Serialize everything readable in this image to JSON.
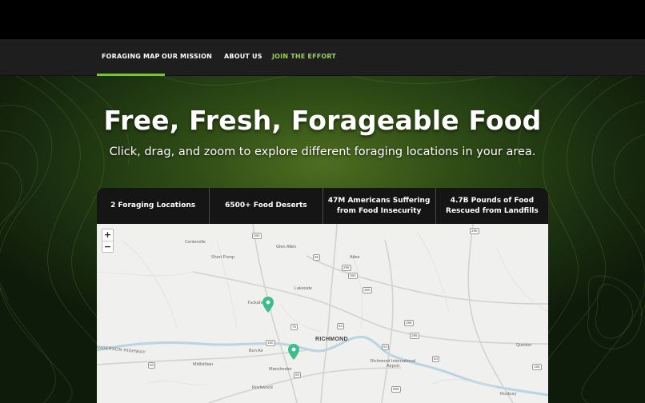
{
  "nav": {
    "items": [
      {
        "label": "FORAGING MAP",
        "active": true
      },
      {
        "label": "OUR MISSION"
      },
      {
        "label": "ABOUT US"
      },
      {
        "label": "JOIN THE EFFORT",
        "accent": true
      }
    ]
  },
  "hero": {
    "title": "Free, Fresh, Forageable Food",
    "subtitle": "Click, drag, and zoom to explore different foraging locations in your area."
  },
  "stats": [
    "2 Foraging Locations",
    "6500+ Food Deserts",
    "47M Americans Suffering from Food Insecurity",
    "4.7B Pounds of Food Rescued from Landfills"
  ],
  "map": {
    "zoom_in": "+",
    "zoom_out": "−",
    "labels": {
      "centerville": "Centerville",
      "glen_allen": "Glen Allen",
      "short_pump": "Short Pump",
      "atlee": "Atlee",
      "lakeside": "Lakeside",
      "tuckahoe": "Tuckahoe",
      "richmond": "RICHMOND",
      "bon_air": "Bon Air",
      "midlothian": "Midlothian",
      "manchester": "Manchester",
      "rockwood": "Rockwood",
      "quinton": "Quinton",
      "airport": "Richmond International Airport",
      "highway": "ANDERSON HIGHWAY",
      "roxbury": "Roxbury"
    },
    "shields": [
      "360",
      "295",
      "95",
      "295",
      "360",
      "64",
      "76",
      "150",
      "64",
      "895",
      "295",
      "60",
      "64",
      "156",
      "60",
      "288",
      "360"
    ],
    "pin_color": "#3dbd8a"
  },
  "colors": {
    "accent": "#7cc04a",
    "nav_bg": "#1e1e1e",
    "stats_bg": "#151515",
    "hero_green": "#3f6a1c"
  }
}
